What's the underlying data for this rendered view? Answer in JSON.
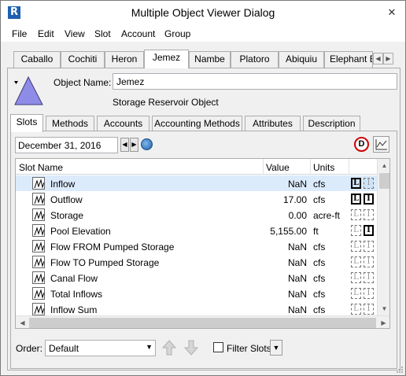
{
  "window": {
    "title": "Multiple Object Viewer Dialog",
    "app_icon_glyph": "R",
    "close_glyph": "✕"
  },
  "menu": [
    "File",
    "Edit",
    "View",
    "Slot",
    "Account",
    "Group"
  ],
  "object_tabs": [
    "Caballo",
    "Cochiti",
    "Heron",
    "Jemez",
    "Nambe",
    "Platoro",
    "Abiquiu",
    "Elephant B"
  ],
  "object_tabs_active": "Jemez",
  "object": {
    "name_label": "Object Name:",
    "name_value": "Jemez",
    "type_text": "Storage Reservoir Object",
    "icon": "reservoir-triangle-icon"
  },
  "slot_tabs": [
    "Slots",
    "Methods",
    "Accounts",
    "Accounting Methods",
    "Attributes",
    "Description"
  ],
  "slot_tabs_active": "Slots",
  "date": {
    "value": "December 31, 2016"
  },
  "table": {
    "columns": [
      "Slot Name",
      "Value",
      "Units"
    ],
    "rows": [
      {
        "name": "Inflow",
        "value": "NaN",
        "units": "cfs",
        "L": true,
        "I": false,
        "selected": true
      },
      {
        "name": "Outflow",
        "value": "17.00",
        "units": "cfs",
        "L": true,
        "I": true,
        "selected": false
      },
      {
        "name": "Storage",
        "value": "0.00",
        "units": "acre-ft",
        "L": false,
        "I": false,
        "selected": false
      },
      {
        "name": "Pool Elevation",
        "value": "5,155.00",
        "units": "ft",
        "L": false,
        "I": true,
        "selected": false
      },
      {
        "name": "Flow FROM Pumped Storage",
        "value": "NaN",
        "units": "cfs",
        "L": false,
        "I": false,
        "selected": false
      },
      {
        "name": "Flow TO Pumped Storage",
        "value": "NaN",
        "units": "cfs",
        "L": false,
        "I": false,
        "selected": false
      },
      {
        "name": "Canal Flow",
        "value": "NaN",
        "units": "cfs",
        "L": false,
        "I": false,
        "selected": false
      },
      {
        "name": "Total Inflows",
        "value": "NaN",
        "units": "cfs",
        "L": false,
        "I": false,
        "selected": false
      },
      {
        "name": "Inflow Sum",
        "value": "NaN",
        "units": "cfs",
        "L": false,
        "I": false,
        "selected": false
      }
    ]
  },
  "footer": {
    "order_label": "Order:",
    "order_value": "Default",
    "filter_label": "Filter Slots",
    "filter_checked": false
  }
}
